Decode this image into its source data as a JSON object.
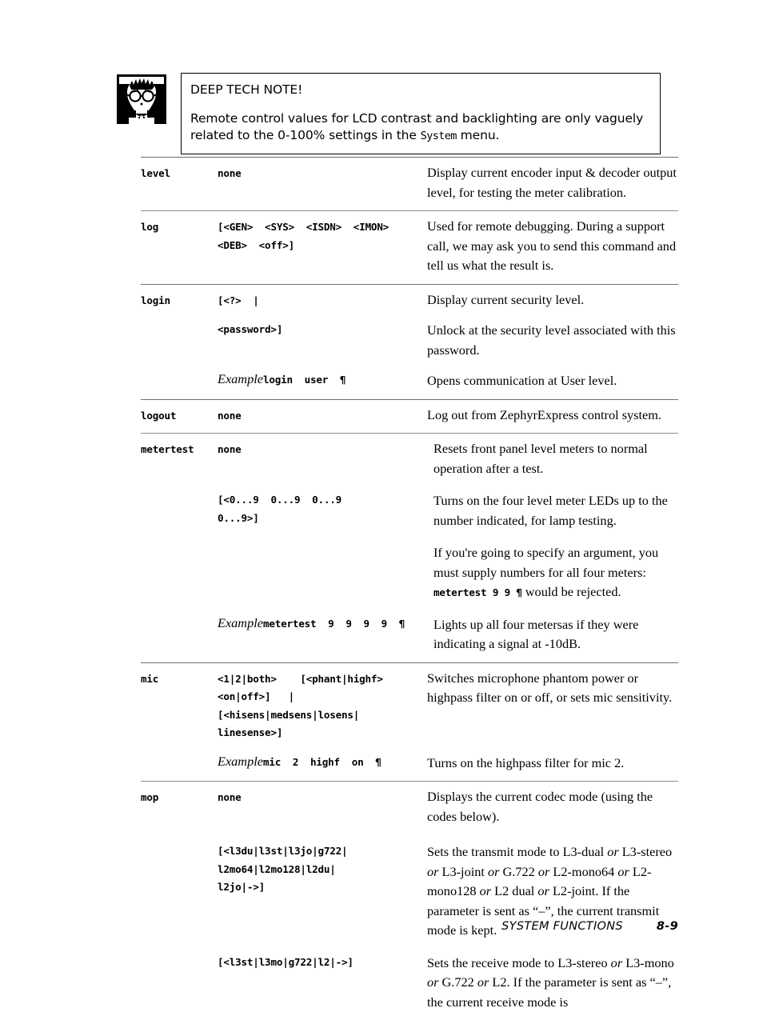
{
  "note": {
    "icon_name": "nerd-face-icon",
    "title": "DEEP TECH NOTE!",
    "body_line1": "Remote control values for LCD contrast and backlighting are only vaguely",
    "body_line2_a": "related to the 0-100% settings in the ",
    "body_line2_mono": "System",
    "body_line2_b": " menu."
  },
  "table": {
    "rows": [
      {
        "command": "level",
        "entries": [
          {
            "arg": "none",
            "desc": "Display current encoder input & decoder output level, for testing the meter calibration."
          }
        ]
      },
      {
        "command": "log",
        "entries": [
          {
            "arg": "[<GEN>  <SYS>  <ISDN>  <IMON>\n<DEB>  <off>]",
            "desc": "Used for remote debugging. During a support call, we may ask you to send this command and tell us what the result is."
          }
        ]
      },
      {
        "command": "login",
        "entries": [
          {
            "arg": "[<?>  |",
            "desc": "Display current security level."
          },
          {
            "arg": "<password>]",
            "desc": "Unlock at the security level associated with this password."
          },
          {
            "example_label": "Example",
            "arg": "login  user  ¶",
            "desc": "Opens communication at User level."
          }
        ]
      },
      {
        "command": "logout",
        "entries": [
          {
            "arg": "none",
            "desc": "Log out from ZephyrExpress control system."
          }
        ]
      },
      {
        "command": "metertest",
        "entries": [
          {
            "arg": "none",
            "desc": "Resets front panel level meters to normal operation after a test."
          },
          {
            "arg": "[<0...9  0...9  0...9\n0...9>]",
            "desc": "Turns on the four level meter LEDs up to the number indicated, for lamp testing."
          },
          {
            "arg": "",
            "desc_pre": "If you're going to specify an argument, you must supply numbers for all four meters: ",
            "desc_mono": "metertest 9 9 ¶",
            "desc_post": " would be rejected."
          },
          {
            "example_label": "Example",
            "arg": "metertest  9  9  9  9  ¶",
            "desc": "Lights up all four metersas if they were indicating a signal at -10dB."
          }
        ]
      },
      {
        "command": "mic",
        "entries": [
          {
            "arg": "<1|2|both>    [<phant|highf>\n<on|off>]   |\n[<hisens|medsens|losens|\nlinesense>]",
            "desc": "Switches microphone phantom power or highpass filter on or off, or sets mic sensitivity."
          },
          {
            "example_label": "Example",
            "arg": "mic  2  highf  on  ¶",
            "desc": "Turns on the highpass filter for mic 2."
          }
        ]
      },
      {
        "command": "mop",
        "entries": [
          {
            "arg": "none",
            "desc": "Displays the current codec mode (using the codes below)."
          },
          {
            "arg": "[<l3du|l3st|l3jo|g722|\nl2mo64|l2mo128|l2du|\nl2jo|->]",
            "desc_rich": "transmit"
          },
          {
            "arg": "[<l3st|l3mo|g722|l2|->]",
            "desc_rich": "receive"
          }
        ]
      }
    ]
  },
  "rich_desc": {
    "transmit": {
      "p1": "Sets the transmit mode to L3-dual ",
      "or1": "or",
      "p2": " L3-stereo ",
      "or2": "or",
      "p3": " L3-joint ",
      "or3": "or",
      "p4": " G.722 ",
      "or4": "or",
      "p5": " L2-mono64 ",
      "or5": "or",
      "p6": " L2-mono128 ",
      "or6": "or",
      "p7": " L2 dual ",
      "or7": "or",
      "p8": " L2-joint. If the parameter is sent as “–”, the current transmit mode is kept."
    },
    "receive": {
      "p1": "Sets the receive mode to L3-stereo ",
      "or1": "or",
      "p2": " L3-mono ",
      "or2": "or",
      "p3": " G.722 ",
      "or3": "or",
      "p4": " L2. If the parameter is sent as “–”, the current receive mode is"
    }
  },
  "footer": {
    "section": "SYSTEM FUNCTIONS",
    "page": "8-9"
  }
}
